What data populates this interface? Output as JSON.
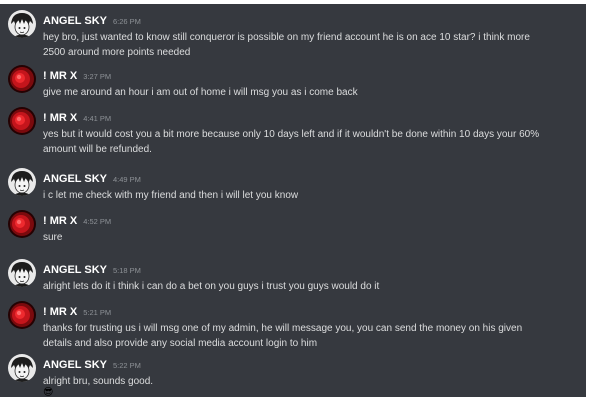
{
  "colors": {
    "background": "#36393f",
    "username": "#ffffff",
    "message_text": "#dcddde",
    "timestamp": "#8e9297",
    "mrx_avatar": "#c4151c"
  },
  "messages": [
    {
      "author": "ANGEL SKY",
      "time": "6:26 PM",
      "avatar_icon": "anime-boy-avatar-icon",
      "text": "hey bro, just wanted to know still conqueror is possible on my friend account he is on ace 10 star? i think more 2500 around more points needed"
    },
    {
      "author": "! MR X",
      "time": "3:27 PM",
      "avatar_icon": "red-glow-avatar-icon",
      "text": "give me around an hour i am out of home i will msg you as i come back"
    },
    {
      "author": "! MR X",
      "time": "4:41 PM",
      "avatar_icon": "red-glow-avatar-icon",
      "text": "yes but it would cost you a bit more because only 10 days left and if it wouldn't be done within 10 days your 60% amount will be refunded."
    },
    {
      "author": "ANGEL SKY",
      "time": "4:49 PM",
      "avatar_icon": "anime-boy-avatar-icon",
      "text": "i c let me check with my friend and then i will let you know"
    },
    {
      "author": "! MR X",
      "time": "4:52 PM",
      "avatar_icon": "red-glow-avatar-icon",
      "text": "sure"
    },
    {
      "author": "ANGEL SKY",
      "time": "5:18 PM",
      "avatar_icon": "anime-boy-avatar-icon",
      "text": "alright lets do it i think i can do a bet on you guys i trust you guys would do it"
    },
    {
      "author": "! MR X",
      "time": "5:21 PM",
      "avatar_icon": "red-glow-avatar-icon",
      "text": "thanks for trusting us i will msg one of my admin, he will message you, you can send the money on his given details and also provide any social media account login to him"
    },
    {
      "author": "ANGEL SKY",
      "time": "5:22 PM",
      "avatar_icon": "anime-boy-avatar-icon",
      "text": "alright bru, sounds good.",
      "emoji": "😎"
    }
  ]
}
